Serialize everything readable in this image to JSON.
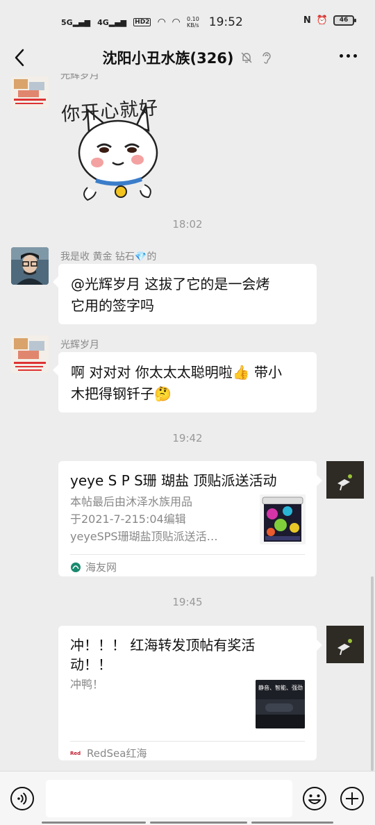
{
  "status_bar": {
    "net1": "5G",
    "net2": "4G",
    "hd": "HD2",
    "speed_value": "0.10",
    "speed_unit": "KB/s",
    "time": "19:52",
    "battery": "46"
  },
  "nav": {
    "title": "沈阳小丑水族(326)"
  },
  "messages": {
    "sticker": {
      "text": "你开心就好",
      "sender_partial": "光辉岁月"
    },
    "time1": "18:02",
    "msg1": {
      "sender": "我是收  黄金  钻石💎的",
      "line1": "@光辉岁月  这拔了它的是一会烤",
      "line2": "它用的签字吗"
    },
    "msg2": {
      "sender": "光辉岁月",
      "line1": "啊 对对对 你太太太聪明啦👍 带小",
      "line2": "木把得钢钎子🤔"
    },
    "time2": "19:42",
    "card1": {
      "title": "yeye S P S珊 瑚盐 顶贴派送活动",
      "desc1": "本帖最后由沐泽水族用品",
      "desc2": "于2021-7-215:04编辑",
      "desc3": "yeyeSPS珊瑚盐顶贴派送活…",
      "source": "海友网"
    },
    "time3": "19:45",
    "card2": {
      "title1": "冲！！！ 红海转发顶帖有奖活",
      "title2": "动！！",
      "desc": "冲鸭！",
      "thumb_text": "静音、智能、强劲",
      "source_logo": "Red Sea",
      "source": "RedSea红海"
    }
  },
  "colors": {
    "background": "#ededed",
    "bubble": "#ffffff",
    "muted": "#888888",
    "self_avatar": "#2e2a24"
  }
}
